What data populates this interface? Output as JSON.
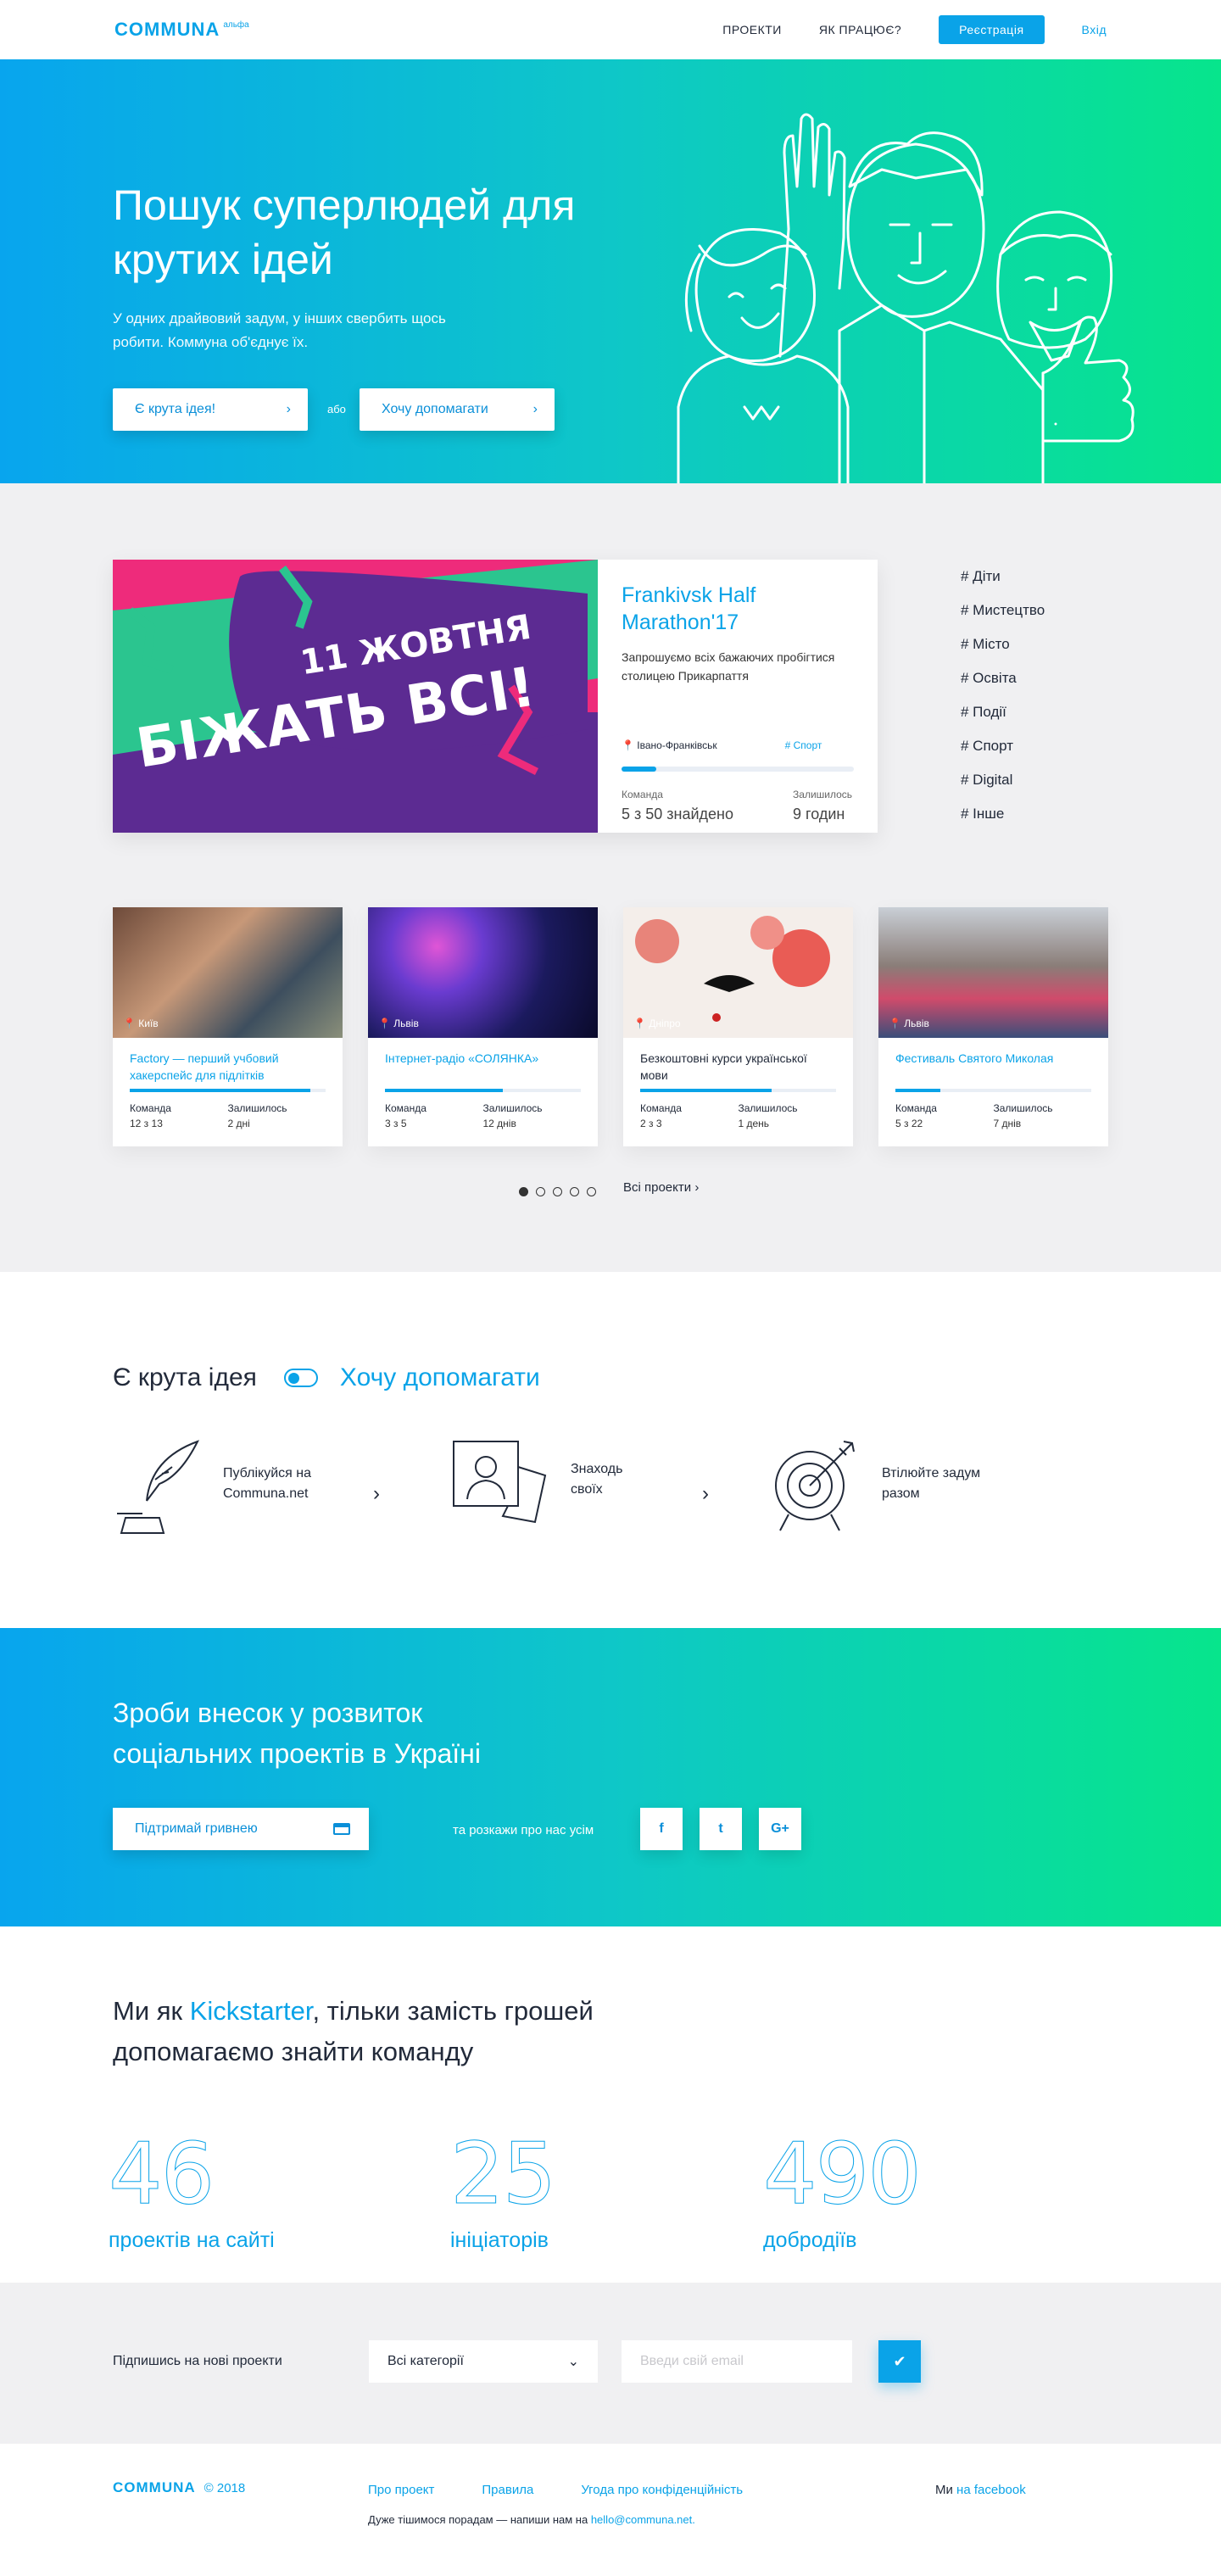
{
  "header": {
    "logo": "COMMUNA",
    "logo_sup": "альфа",
    "nav": [
      "ПРОЕКТИ",
      "ЯК ПРАЦЮЄ?"
    ],
    "register": "Реєстрація",
    "login": "Вхід"
  },
  "hero": {
    "title": "Пошук суперлюдей для крутих ідей",
    "subtitle": "У одних драйвовий задум, у інших свербить щось робити. Коммуна об'єднує їх.",
    "cta_idea": "Є крута ідея!",
    "or": "або",
    "cta_help": "Хочу допомагати"
  },
  "featured": {
    "banner_line1": "11 ЖОВТНЯ",
    "banner_line2": "БІЖАТЬ ВСІ!",
    "title": "Frankivsk Half Marathon'17",
    "desc": "Запрошуємо всіх бажаючих пробігтися столицею Прикарпаття",
    "city": "Івано-Франківськ",
    "tag": "# Спорт",
    "progress": 0.15,
    "team_label": "Команда",
    "team_value": "5 з 50 знайдено",
    "left_label": "Залишилось",
    "left_value": "9 годин"
  },
  "categories": [
    "# Діти",
    "# Мистецтво",
    "# Місто",
    "# Освіта",
    "# Події",
    "# Спорт",
    "# Digital",
    "# Інше"
  ],
  "projects": [
    {
      "city": "Київ",
      "title": "Factory — перший учбовий хакерспейс для підлітків",
      "blue": true,
      "progress": 0.92,
      "team_label": "Команда",
      "team": "12 з 13",
      "left_label": "Залишилось",
      "left": "2 дні"
    },
    {
      "city": "Львів",
      "title": "Інтернет-радіо «СОЛЯНКА»",
      "blue": true,
      "progress": 0.6,
      "team_label": "Команда",
      "team": "3 з 5",
      "left_label": "Залишилось",
      "left": "12 днів"
    },
    {
      "city": "Дніпро",
      "title": "Безкоштовні курси української мови",
      "blue": false,
      "progress": 0.67,
      "team_label": "Команда",
      "team": "2 з 3",
      "left_label": "Залишилось",
      "left": "1 день"
    },
    {
      "city": "Львів",
      "title": "Фестиваль Святого Миколая",
      "blue": true,
      "progress": 0.23,
      "team_label": "Команда",
      "team": "5 з 22",
      "left_label": "Залишилось",
      "left": "7 днів"
    }
  ],
  "all_projects": "Всі проекти",
  "how": {
    "left": "Є крута ідея",
    "right": "Хочу допомагати",
    "steps": [
      "Публікуйся на Communa.net",
      "Знаходь своїх",
      "Втілюйте задум разом"
    ]
  },
  "contrib": {
    "title": "Зроби внесок у розвиток соціальних проектів в Україні",
    "donate": "Підтримай гривнею",
    "share": "та розкажи про нас усім",
    "social": [
      "f",
      "t",
      "G+"
    ]
  },
  "kick": {
    "pre": "Ми як ",
    "highlight": "Kickstarter",
    "post": ", тільки замість грошей допомагаємо знайти команду",
    "stats": [
      {
        "n": "46",
        "l": "проектів на сайті"
      },
      {
        "n": "25",
        "l": "ініціаторів"
      },
      {
        "n": "490",
        "l": "добродіїв"
      }
    ]
  },
  "subscribe": {
    "label": "Підпишись на нові проекти",
    "select": "Всі категорії",
    "placeholder": "Введи свій email"
  },
  "footer": {
    "logo": "COMMUNA",
    "year": "© 2018",
    "links": [
      "Про проект",
      "Правила",
      "Угода про конфіденційність"
    ],
    "fb_pre": "Ми ",
    "fb_link": "на facebook",
    "note_pre": "Дуже тішимося порадам — напиши нам на ",
    "email": "hello@communa.net."
  },
  "colors": {
    "accent": "#0aa3e8",
    "grad_start": "#08a5ee",
    "grad_end": "#07e58c"
  }
}
